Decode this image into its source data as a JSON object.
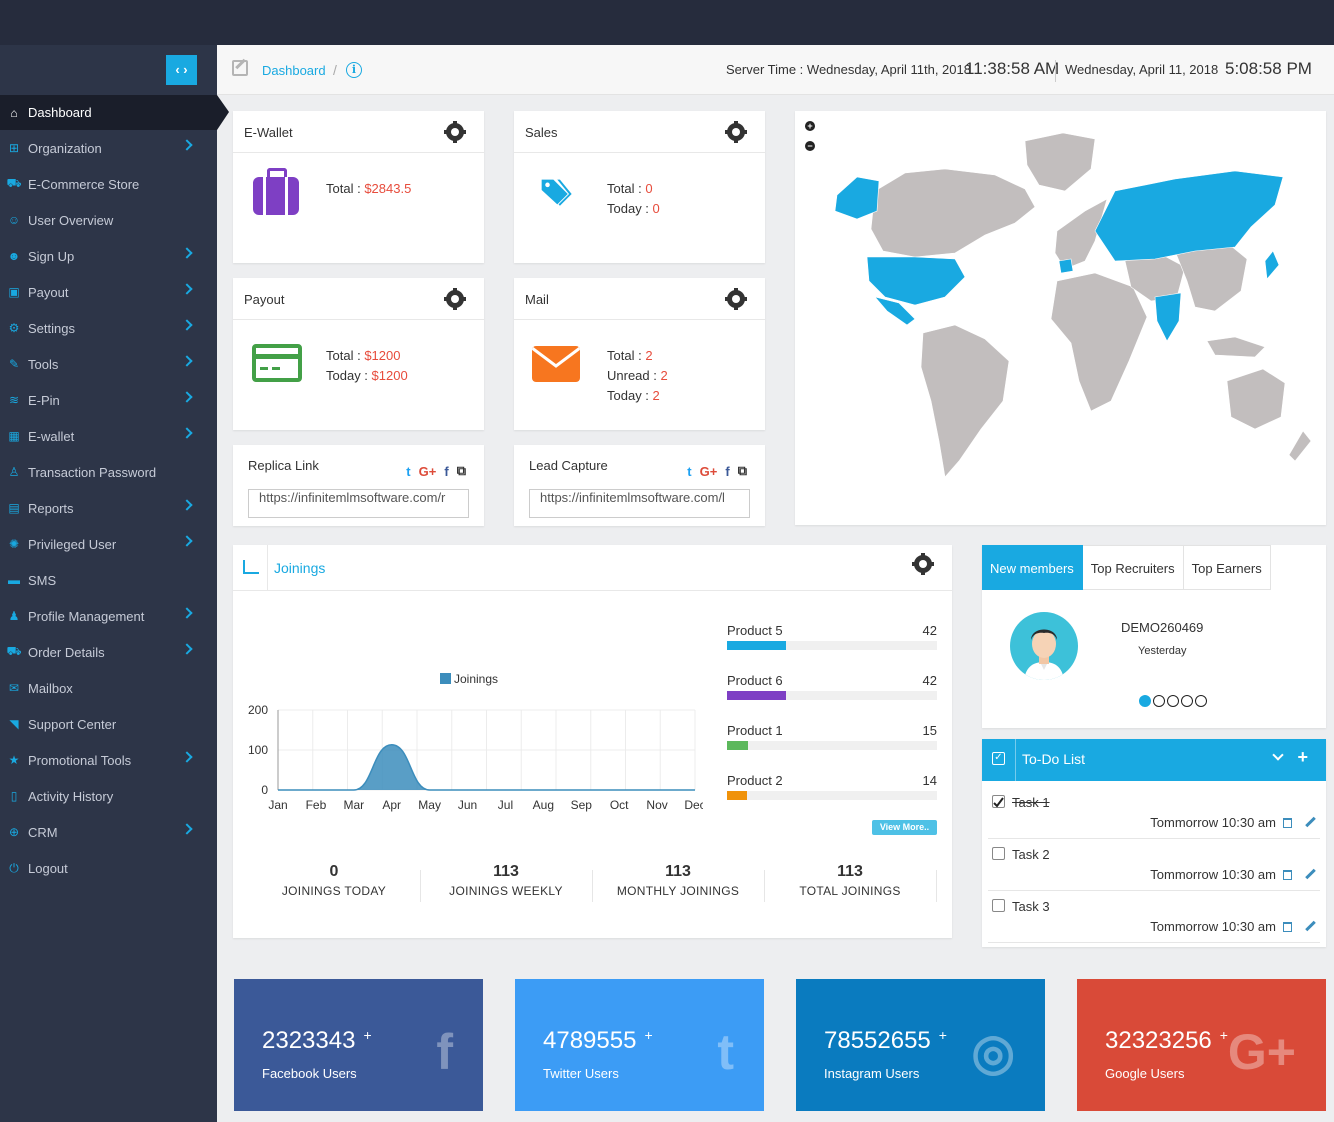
{
  "sidebar": {
    "items": [
      {
        "label": "Dashboard",
        "icon": "home-icon",
        "chevron": false,
        "active": true
      },
      {
        "label": "Organization",
        "icon": "sitemap-icon",
        "chevron": true
      },
      {
        "label": "E-Commerce Store",
        "icon": "cart-icon",
        "chevron": false
      },
      {
        "label": "User Overview",
        "icon": "user-icon",
        "chevron": false
      },
      {
        "label": "Sign Up",
        "icon": "user-plus-icon",
        "chevron": true
      },
      {
        "label": "Payout",
        "icon": "money-icon",
        "chevron": true
      },
      {
        "label": "Settings",
        "icon": "gear-icon",
        "chevron": true
      },
      {
        "label": "Tools",
        "icon": "wrench-icon",
        "chevron": true
      },
      {
        "label": "E-Pin",
        "icon": "layers-icon",
        "chevron": true
      },
      {
        "label": "E-wallet",
        "icon": "calendar-icon",
        "chevron": true
      },
      {
        "label": "Transaction Password",
        "icon": "person-lock-icon",
        "chevron": false
      },
      {
        "label": "Reports",
        "icon": "report-icon",
        "chevron": true
      },
      {
        "label": "Privileged User",
        "icon": "cog-icon",
        "chevron": true
      },
      {
        "label": "SMS",
        "icon": "chat-icon",
        "chevron": false
      },
      {
        "label": "Profile Management",
        "icon": "users-icon",
        "chevron": true
      },
      {
        "label": "Order Details",
        "icon": "cart-icon",
        "chevron": true
      },
      {
        "label": "Mailbox",
        "icon": "mail-icon",
        "chevron": false
      },
      {
        "label": "Support Center",
        "icon": "rss-icon",
        "chevron": false
      },
      {
        "label": "Promotional Tools",
        "icon": "star-icon",
        "chevron": true
      },
      {
        "label": "Activity History",
        "icon": "book-icon",
        "chevron": false
      },
      {
        "label": "CRM",
        "icon": "network-icon",
        "chevron": true
      },
      {
        "label": "Logout",
        "icon": "power-icon",
        "chevron": false
      }
    ]
  },
  "breadcrumb": {
    "link": "Dashboard",
    "separator": "/"
  },
  "clock": {
    "server_label": "Server Time : Wednesday, April 11th, 2018",
    "server_time": "11:38:58 AM",
    "local_date": "Wednesday, April 11, 2018",
    "local_time": "5:08:58 PM"
  },
  "ewallet": {
    "title": "E-Wallet",
    "total_label": "Total :",
    "total_value": "$2843.5"
  },
  "sales": {
    "title": "Sales",
    "total_label": "Total :",
    "total_value": "0",
    "today_label": "Today :",
    "today_value": "0"
  },
  "payout": {
    "title": "Payout",
    "total_label": "Total :",
    "total_value": "$1200",
    "today_label": "Today :",
    "today_value": "$1200"
  },
  "mail": {
    "title": "Mail",
    "total_label": "Total :",
    "total_value": "2",
    "unread_label": "Unread :",
    "unread_value": "2",
    "today_label": "Today :",
    "today_value": "2"
  },
  "replica": {
    "title": "Replica Link",
    "url": "https://infinitemlmsoftware.com/r"
  },
  "lead": {
    "title": "Lead Capture",
    "url": "https://infinitemlmsoftware.com/l"
  },
  "map": {
    "zoom_in": "+",
    "zoom_out": "−",
    "highlight_color": "#19a9e1",
    "land_color": "#c2bebe"
  },
  "joinings": {
    "title": "Joinings",
    "view_more": "View More..",
    "stats": [
      {
        "value": "0",
        "label": "JOININGS TODAY"
      },
      {
        "value": "113",
        "label": "JOININGS WEEKLY"
      },
      {
        "value": "113",
        "label": "MONTHLY JOININGS"
      },
      {
        "value": "113",
        "label": "TOTAL JOININGS"
      }
    ],
    "products": [
      {
        "name": "Product 5",
        "value": 42,
        "color": "#19a9e1"
      },
      {
        "name": "Product 6",
        "value": 42,
        "color": "#7e3fc4"
      },
      {
        "name": "Product 1",
        "value": 15,
        "color": "#5cb85c"
      },
      {
        "name": "Product 2",
        "value": 14,
        "color": "#f0920a"
      }
    ],
    "product_max": 150
  },
  "chart_data": {
    "type": "area",
    "categories": [
      "Jan",
      "Feb",
      "Mar",
      "Apr",
      "May",
      "Jun",
      "Jul",
      "Aug",
      "Sep",
      "Oct",
      "Nov",
      "Dec"
    ],
    "series": [
      {
        "name": "Joinings",
        "values": [
          0,
          0,
          0,
          113,
          0,
          0,
          0,
          0,
          0,
          0,
          0,
          0
        ],
        "color": "#3c8dbc"
      }
    ],
    "yticks": [
      0,
      100,
      200
    ],
    "ylim": [
      0,
      200
    ],
    "grid": true,
    "legend": "top-center"
  },
  "members": {
    "tabs": [
      "New members",
      "Top Recruiters",
      "Top Earners"
    ],
    "name": "DEMO260469",
    "when": "Yesterday"
  },
  "todo": {
    "title": "To-Do List",
    "items": [
      {
        "label": "Task 1",
        "time": "Tommorrow 10:30 am",
        "done": true
      },
      {
        "label": "Task 2",
        "time": "Tommorrow 10:30 am",
        "done": false
      },
      {
        "label": "Task 3",
        "time": "Tommorrow 10:30 am",
        "done": false
      }
    ]
  },
  "social": [
    {
      "count": "2323343",
      "plus": "+",
      "label": "Facebook Users",
      "glyph": "f",
      "color": "#3b5998"
    },
    {
      "count": "4789555",
      "plus": "+",
      "label": "Twitter Users",
      "glyph": "t",
      "color": "#3c9cf5"
    },
    {
      "count": "78552655",
      "plus": "+",
      "label": "Instagram Users",
      "glyph": "◎",
      "color": "#0a7bbf"
    },
    {
      "count": "32323256",
      "plus": "+",
      "label": "Google Users",
      "glyph": "G+",
      "color": "#d94a38"
    }
  ]
}
